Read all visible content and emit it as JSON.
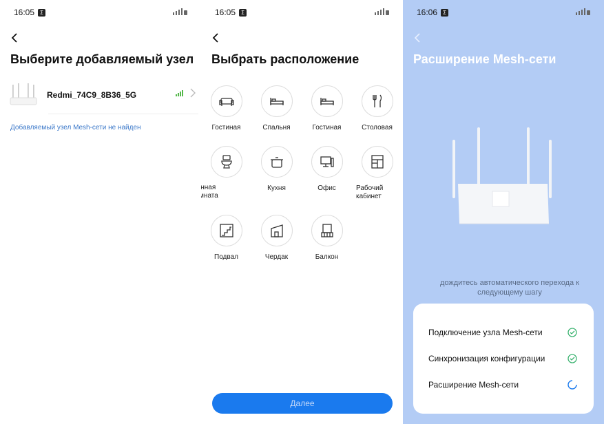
{
  "screen1": {
    "status": {
      "time": "16:05",
      "badge": "Σ"
    },
    "title": "Выберите добавляемый узел",
    "node": {
      "name": "Redmi_74C9_8B36_5G"
    },
    "not_found": "Добавляемый узел Mesh-сети не найден"
  },
  "screen2": {
    "status": {
      "time": "16:05",
      "badge": "Σ"
    },
    "title": "Выбрать расположение",
    "locations": [
      {
        "label": "Гостиная",
        "icon": "sofa-icon"
      },
      {
        "label": "Спальня",
        "icon": "bed-icon"
      },
      {
        "label": "Гостиная",
        "icon": "bed-icon"
      },
      {
        "label": "Столовая",
        "icon": "cutlery-icon"
      },
      {
        "label": "Ванная комната",
        "icon": "toilet-icon"
      },
      {
        "label": "Кухня",
        "icon": "pot-icon"
      },
      {
        "label": "Офис",
        "icon": "computer-icon"
      },
      {
        "label": "Рабочий кабинет",
        "icon": "cabinet-icon"
      },
      {
        "label": "Подвал",
        "icon": "stairs-icon"
      },
      {
        "label": "Чердак",
        "icon": "attic-icon"
      },
      {
        "label": "Балкон",
        "icon": "balcony-icon"
      }
    ],
    "next_label": "Далее"
  },
  "screen3": {
    "status": {
      "time": "16:06",
      "badge": "Σ"
    },
    "title": "Расширение Mesh-сети",
    "wait_text": "дождитесь автоматического перехода к следующему шагу",
    "steps": [
      {
        "label": "Подключение узла Mesh-сети",
        "state": "done"
      },
      {
        "label": "Синхронизация конфигурации",
        "state": "done"
      },
      {
        "label": "Расширение Mesh-сети",
        "state": "loading"
      }
    ]
  },
  "colors": {
    "accent": "#1a7aee",
    "link": "#3b78c9",
    "success": "#3cb371",
    "panel": "#b3ccf5"
  }
}
